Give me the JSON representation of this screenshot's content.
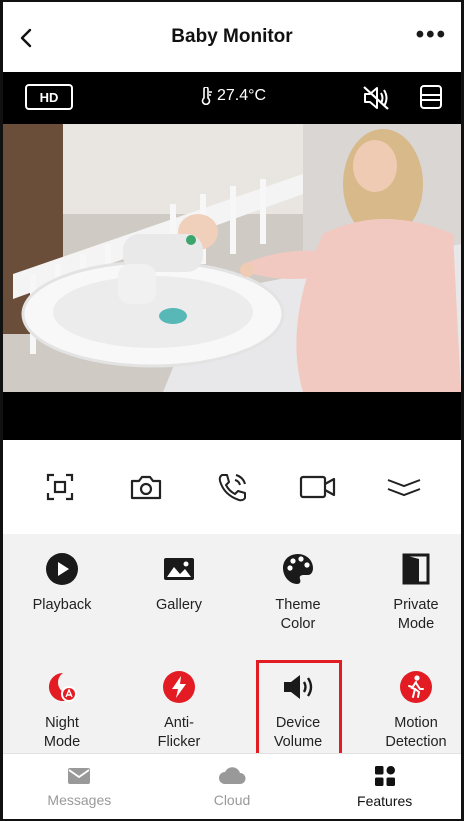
{
  "header": {
    "title": "Baby Monitor",
    "more_label": "•••"
  },
  "video": {
    "quality_label": "HD",
    "temperature": "27.4°C"
  },
  "controls": [
    {
      "icon": "fullscreen-icon"
    },
    {
      "icon": "camera-icon"
    },
    {
      "icon": "talk-icon"
    },
    {
      "icon": "record-icon"
    },
    {
      "icon": "collapse-icon"
    }
  ],
  "features": [
    {
      "label": "Playback",
      "icon": "play-icon",
      "color": "#1a1a1a"
    },
    {
      "label": "Gallery",
      "icon": "gallery-icon",
      "color": "#1a1a1a"
    },
    {
      "label": "Theme\nColor",
      "icon": "palette-icon",
      "color": "#1a1a1a"
    },
    {
      "label": "Private\nMode",
      "icon": "private-mode-icon",
      "color": "#1a1a1a"
    },
    {
      "label": "Night\nMode",
      "icon": "night-mode-icon",
      "color": "#e31b23"
    },
    {
      "label": "Anti-\nFlicker",
      "icon": "flash-icon",
      "color": "#e31b23"
    },
    {
      "label": "Device\nVolume",
      "icon": "volume-icon",
      "color": "#1a1a1a"
    },
    {
      "label": "Motion\nDetection",
      "icon": "motion-icon",
      "color": "#e31b23"
    }
  ],
  "tabs": [
    {
      "label": "Messages",
      "icon": "messages-icon"
    },
    {
      "label": "Cloud",
      "icon": "cloud-icon"
    },
    {
      "label": "Features",
      "icon": "features-icon",
      "active": true
    }
  ],
  "colors": {
    "accent_red": "#e31b23",
    "video_bg": "#000000",
    "panel_bg": "#f2f2f2"
  }
}
